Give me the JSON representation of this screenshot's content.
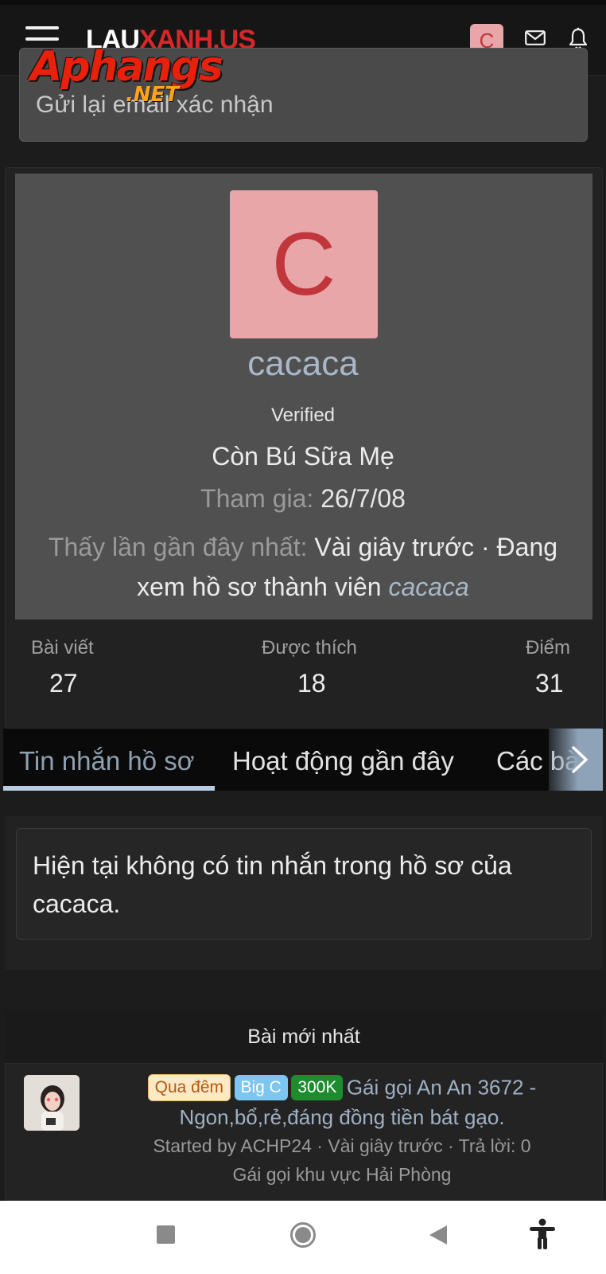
{
  "header": {
    "logo_part1": "LAU",
    "logo_part2": "XANH.US",
    "watermark_main": "Aphangs",
    "watermark_sub": ".NET",
    "user_initial": "C"
  },
  "email_notice": {
    "resend_label": "Gửi lại email xác nhận"
  },
  "profile": {
    "avatar_letter": "C",
    "username": "cacaca",
    "status": "Verified",
    "title": "Còn Bú Sữa Mẹ",
    "joined_label": "Tham gia:",
    "joined_value": "26/7/08",
    "last_seen_label": "Thấy lần gần đây nhất:",
    "last_seen_value": "Vài giây trước · Đang xem hồ sơ thành viên",
    "last_seen_user": "cacaca",
    "stats": [
      {
        "label": "Bài viết",
        "value": "27"
      },
      {
        "label": "Được thích",
        "value": "18"
      },
      {
        "label": "Điểm",
        "value": "31"
      }
    ]
  },
  "tabs": [
    "Tin nhắn hồ sơ",
    "Hoạt động gần đây",
    "Các bài"
  ],
  "profile_messages": {
    "empty_text": "Hiện tại không có tin nhắn trong hồ sơ của cacaca."
  },
  "latest_posts": {
    "heading": "Bài mới nhất",
    "items": [
      {
        "badges": [
          {
            "text": "Qua đêm",
            "color": "#fde9c6"
          },
          {
            "text": "Big C",
            "color": "#7cc6f0"
          },
          {
            "text": "300K",
            "color": "#1e8c2e"
          }
        ],
        "title_part1": "Gái gọi An An 3672 -",
        "title_part2": "Ngon,bổ,rẻ,đáng đồng tiền bát gạo.",
        "meta": "Started by ACHP24 · Vài giây trước · Trả lời: 0",
        "forum": "Gái gọi khu vực Hải Phòng"
      }
    ]
  },
  "theme": {
    "background": "#1c1c1c",
    "panel": "#505050",
    "accent_link": "#a9b8c8",
    "avatar_bg": "#e8a6a8"
  }
}
